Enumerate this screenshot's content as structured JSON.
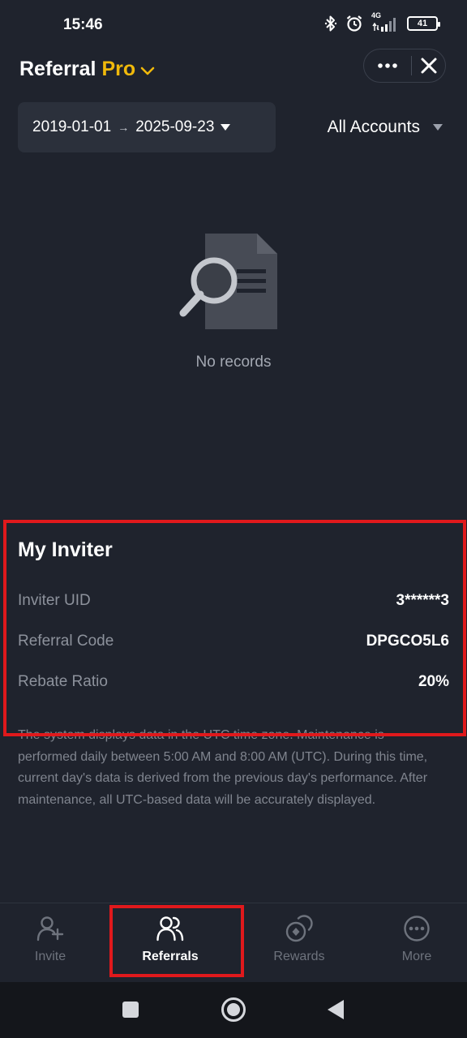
{
  "status_bar": {
    "time": "15:46",
    "network": "4G",
    "battery": "41",
    "icons": [
      "bluetooth-icon",
      "alarm-icon",
      "signal-icon",
      "battery-icon"
    ]
  },
  "header": {
    "title_main": "Referral",
    "title_accent": "Pro",
    "accent_color": "#f0b90b"
  },
  "filters": {
    "date_start": "2019-01-01",
    "date_arrow": "→",
    "date_end": "2025-09-23",
    "account": "All Accounts"
  },
  "empty_state": {
    "text": "No records"
  },
  "inviter": {
    "title": "My Inviter",
    "rows": [
      {
        "label": "Inviter UID",
        "value": "3******3"
      },
      {
        "label": "Referral Code",
        "value": "DPGCO5L6"
      },
      {
        "label": "Rebate Ratio",
        "value": "20%"
      }
    ]
  },
  "notice": "The system displays data in the UTC time zone. Maintenance is performed daily between 5:00 AM and 8:00 AM (UTC). During this time, current day's data is derived from the previous day's performance. After maintenance, all UTC-based data will be accurately displayed.",
  "bottom_nav": {
    "items": [
      {
        "label": "Invite",
        "icon": "add-user-icon",
        "active": false
      },
      {
        "label": "Referrals",
        "icon": "users-icon",
        "active": true
      },
      {
        "label": "Rewards",
        "icon": "rewards-icon",
        "active": false
      },
      {
        "label": "More",
        "icon": "more-circle-icon",
        "active": false
      }
    ]
  },
  "colors": {
    "background": "#1f232d",
    "highlight": "#e0191c"
  }
}
